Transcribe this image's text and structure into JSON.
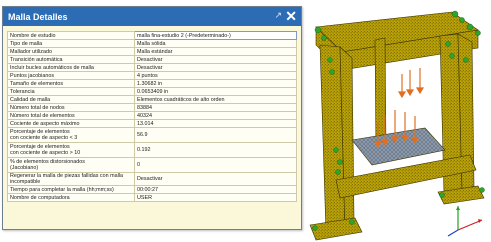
{
  "dialog": {
    "title": "Malla Detalles",
    "pin_icon": "pin-icon",
    "close_icon": "close-icon",
    "rows": [
      {
        "key": "Nombre de estudio",
        "value": "malla fina-estudio 2 (-Predeterminado-)"
      },
      {
        "key": "Tipo de malla",
        "value": "Malla sólida"
      },
      {
        "key": "Mallador utilizado",
        "value": "Malla estándar"
      },
      {
        "key": "Transición automática",
        "value": "Desactivar"
      },
      {
        "key": "Incluir bucles automáticos de malla",
        "value": "Desactivar"
      },
      {
        "key": "Puntos jacobianos",
        "value": "4 puntos"
      },
      {
        "key": "Tamaño de elementos",
        "value": "1.30682 in"
      },
      {
        "key": "Tolerancia",
        "value": "0.0653409 in"
      },
      {
        "key": "Calidad de malla",
        "value": "Elementos cuadráticos de alto orden"
      },
      {
        "key": "Número total de nodos",
        "value": "83884"
      },
      {
        "key": "Número total de elementos",
        "value": "40324"
      },
      {
        "key": "Cociente de aspecto máximo",
        "value": "13.014"
      },
      {
        "key": "Porcentaje de elementos\ncon cociente de aspecto < 3",
        "value": "56.9"
      },
      {
        "key": "Porcentaje de elementos\ncon cociente de aspecto > 10",
        "value": "0.192"
      },
      {
        "key": "% de elementos distorsionados\n(Jacobiano)",
        "value": "0"
      },
      {
        "key": "Regenerar la malla de piezas fallidas con malla incompatible",
        "value": "Desactivar"
      },
      {
        "key": "Tiempo para completar la malla (hh;mm;ss)",
        "value": "00:00:27"
      },
      {
        "key": "Nombre de computadora",
        "value": "USER"
      }
    ]
  },
  "colors": {
    "title_bar": "#2b6cb4",
    "panel_bg": "#fbf7d9",
    "mesh_frame": "#d8c000",
    "fixture_markers": "#2da52d",
    "load_arrows": "#e07020",
    "platen": "#7a8aa0"
  },
  "icons": [
    "close-icon",
    "pin-icon",
    "triad-icon"
  ]
}
